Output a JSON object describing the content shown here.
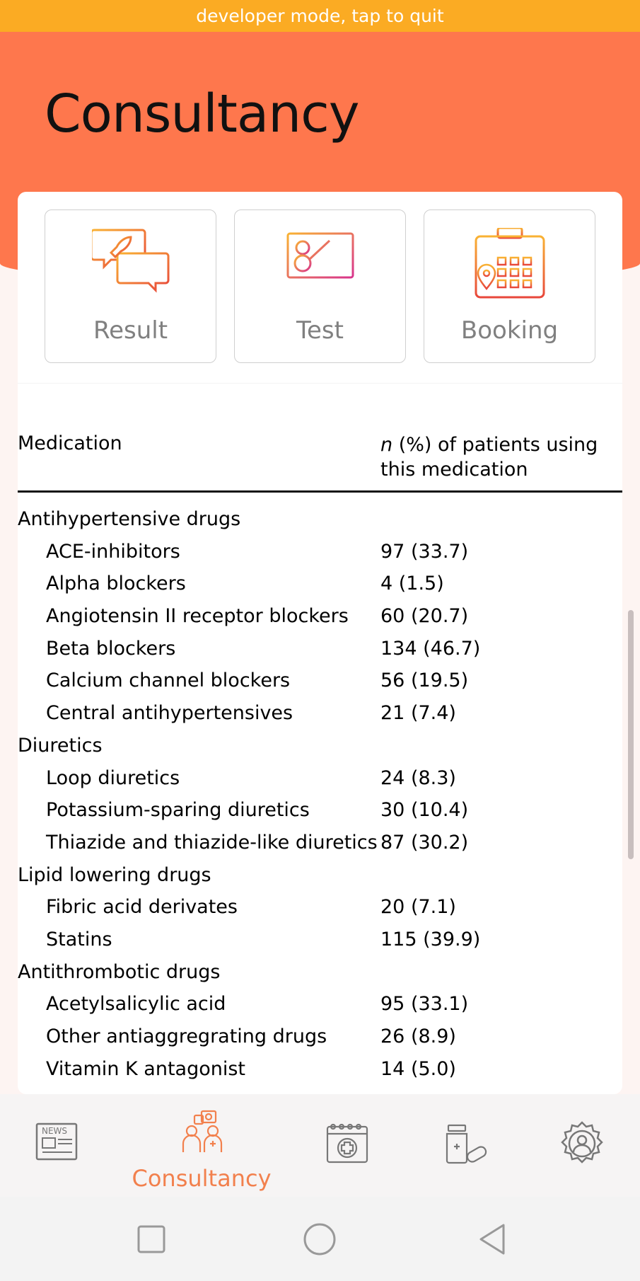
{
  "status_bar": {
    "text": "developer mode, tap to quit"
  },
  "header": {
    "title": "Consultancy"
  },
  "tiles": [
    {
      "label": "Result",
      "icon": "chat-rocket-icon"
    },
    {
      "label": "Test",
      "icon": "monitor-anatomy-icon"
    },
    {
      "label": "Booking",
      "icon": "calendar-icon"
    }
  ],
  "table": {
    "col1_header": "Medication",
    "col2_header_prefix": "n",
    "col2_header_rest": " (%) of patients using this medication",
    "rows": [
      {
        "label": "Antihypertensive drugs",
        "value": "",
        "type": "group"
      },
      {
        "label": "ACE-inhibitors",
        "value": "97 (33.7)",
        "type": "item"
      },
      {
        "label": "Alpha blockers",
        "value": "4 (1.5)",
        "type": "item"
      },
      {
        "label": "Angiotensin II receptor blockers",
        "value": "60 (20.7)",
        "type": "item"
      },
      {
        "label": "Beta blockers",
        "value": "134 (46.7)",
        "type": "item"
      },
      {
        "label": "Calcium channel blockers",
        "value": "56 (19.5)",
        "type": "item"
      },
      {
        "label": "Central antihypertensives",
        "value": "21 (7.4)",
        "type": "item"
      },
      {
        "label": "Diuretics",
        "value": "",
        "type": "group"
      },
      {
        "label": "Loop diuretics",
        "value": "24 (8.3)",
        "type": "item"
      },
      {
        "label": "Potassium-sparing diuretics",
        "value": "30 (10.4)",
        "type": "item"
      },
      {
        "label": "Thiazide and thiazide-like diuretics",
        "value": "87 (30.2)",
        "type": "item"
      },
      {
        "label": "Lipid lowering drugs",
        "value": "",
        "type": "group"
      },
      {
        "label": "Fibric acid derivates",
        "value": "20 (7.1)",
        "type": "item"
      },
      {
        "label": "Statins",
        "value": "115 (39.9)",
        "type": "item"
      },
      {
        "label": "Antithrombotic drugs",
        "value": "",
        "type": "group"
      },
      {
        "label": "Acetylsalicylic acid",
        "value": "95 (33.1)",
        "type": "item"
      },
      {
        "label": "Other antiaggregrating drugs",
        "value": "26 (8.9)",
        "type": "item"
      },
      {
        "label": "Vitamin K antagonist",
        "value": "14 (5.0)",
        "type": "item"
      }
    ]
  },
  "bottom_nav": {
    "items": [
      {
        "icon": "news-icon",
        "label": ""
      },
      {
        "icon": "doctors-icon",
        "label": "Consultancy",
        "active": true
      },
      {
        "icon": "medical-calendar-icon",
        "label": ""
      },
      {
        "icon": "medicine-icon",
        "label": ""
      },
      {
        "icon": "profile-settings-icon",
        "label": ""
      }
    ],
    "news_icon_text": "NEWS",
    "active_color": "#f2804d"
  },
  "colors": {
    "status_bar": "#fbab23",
    "header": "#fe774d",
    "accent": "#f2804d"
  }
}
